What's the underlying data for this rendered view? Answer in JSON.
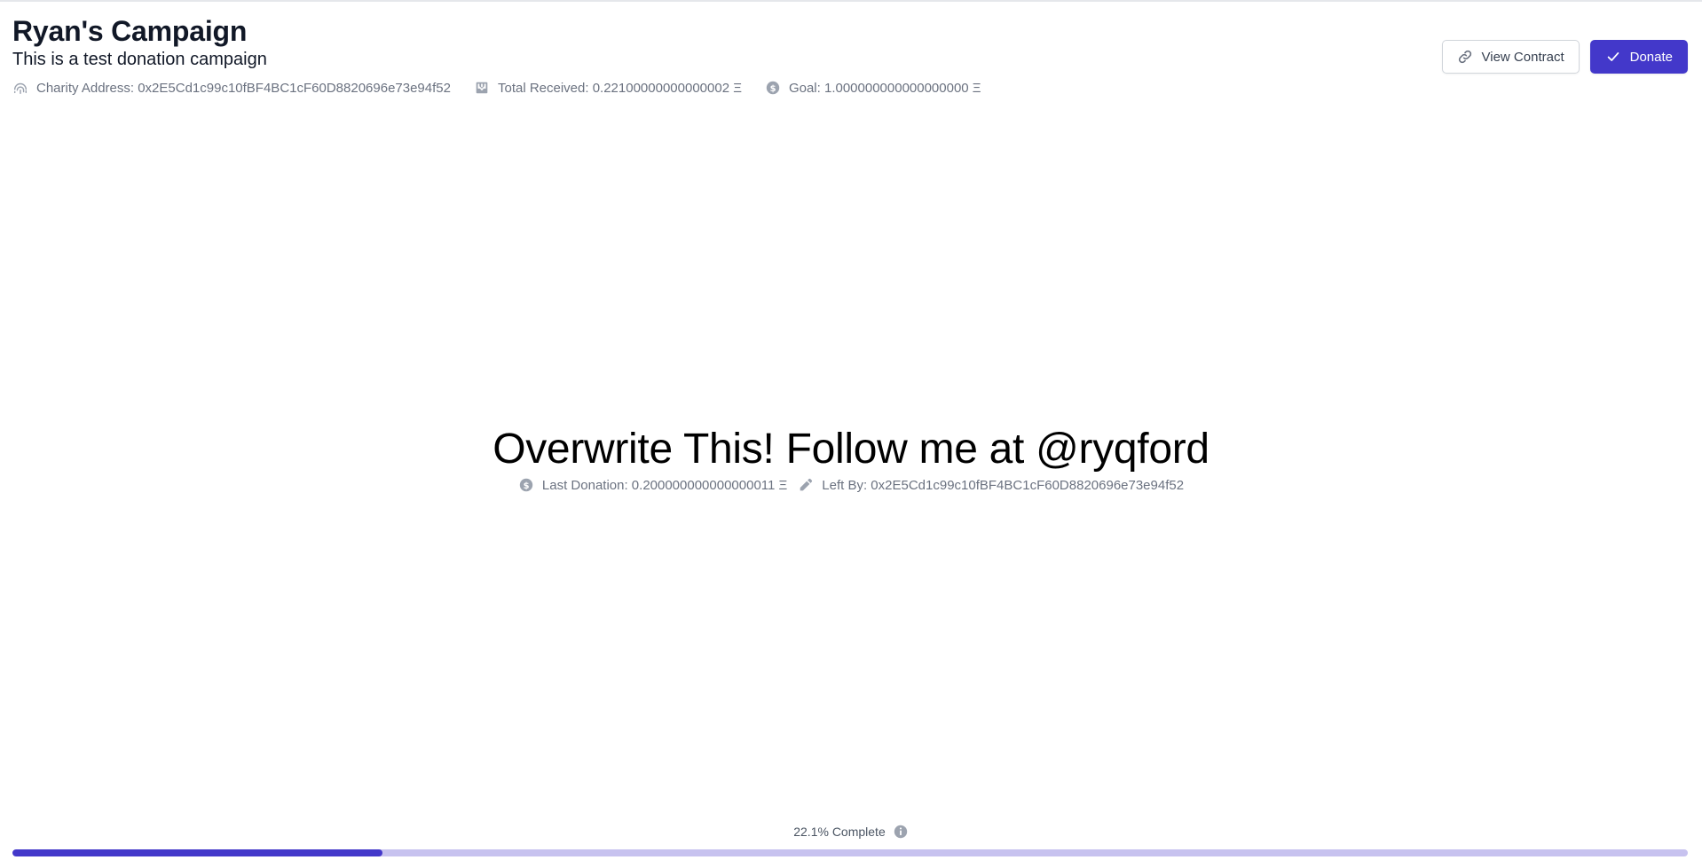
{
  "campaign": {
    "title": "Ryan's Campaign",
    "description": "This is a test donation campaign"
  },
  "meta": {
    "charity_address": "Charity Address: 0x2E5Cd1c99c10fBF4BC1cF60D8820696e73e94f52",
    "total_received": "Total Received: 0.22100000000000002 Ξ",
    "goal": "Goal: 1.000000000000000000 Ξ"
  },
  "actions": {
    "view_contract_label": "View Contract",
    "donate_label": "Donate"
  },
  "message": {
    "text": "Overwrite This! Follow me at @ryqford",
    "last_donation": "Last Donation: 0.200000000000000011 Ξ",
    "left_by": "Left By: 0x2E5Cd1c99c10fBF4BC1cF60D8820696e73e94f52"
  },
  "progress": {
    "label": "22.1% Complete",
    "fraction": 0.221
  },
  "colors": {
    "accent": "#4338ca",
    "progress_track": "#c7c2ef",
    "muted_text": "#6b7280"
  },
  "icons": {
    "charity_address": "fingerprint-icon",
    "total_received": "inbox-download-icon",
    "goal": "currency-dollar-icon",
    "view_contract": "link-icon",
    "donate": "check-icon",
    "last_donation": "currency-dollar-icon",
    "left_by": "pencil-icon",
    "progress_info": "info-icon"
  }
}
